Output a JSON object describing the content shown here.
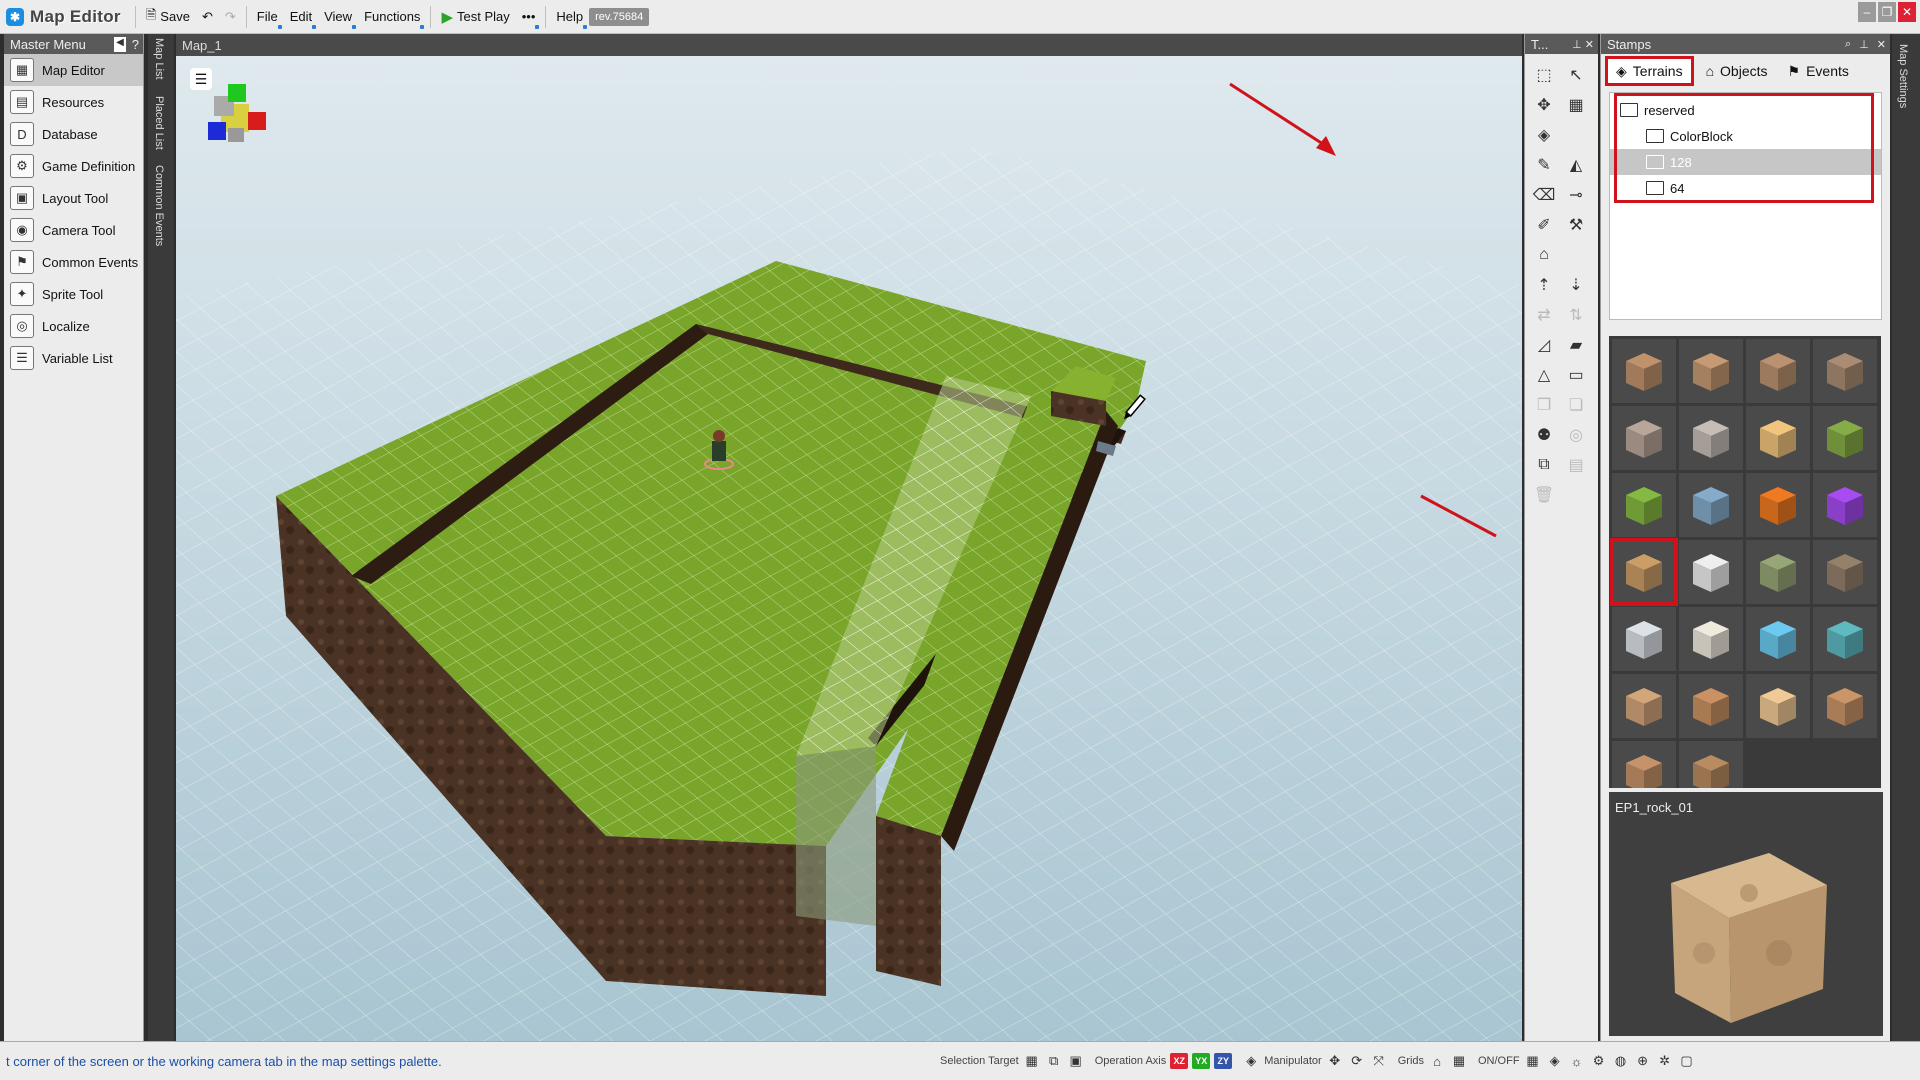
{
  "app": {
    "title": "Map Editor",
    "revision": "rev.75684"
  },
  "toolbar": {
    "save_label": "Save",
    "menus": [
      "File",
      "Edit",
      "View",
      "Functions"
    ],
    "test_play_label": "Test Play",
    "more_label": "•••",
    "help_label": "Help"
  },
  "master_menu": {
    "title": "Master Menu",
    "help": "?",
    "items": [
      {
        "label": "Map Editor",
        "icon": "map-editor-icon"
      },
      {
        "label": "Resources",
        "icon": "resources-icon"
      },
      {
        "label": "Database",
        "icon": "database-icon"
      },
      {
        "label": "Game Definition",
        "icon": "game-definition-icon"
      },
      {
        "label": "Layout Tool",
        "icon": "layout-tool-icon"
      },
      {
        "label": "Camera Tool",
        "icon": "camera-tool-icon"
      },
      {
        "label": "Common Events",
        "icon": "common-events-icon"
      },
      {
        "label": "Sprite Tool",
        "icon": "sprite-tool-icon"
      },
      {
        "label": "Localize",
        "icon": "localize-icon"
      },
      {
        "label": "Variable List",
        "icon": "variable-list-icon"
      }
    ]
  },
  "side_tabs": [
    "Map List",
    "Placed List",
    "Common Events"
  ],
  "viewport": {
    "tab": "Map_1"
  },
  "toolbox": {
    "title": "T..."
  },
  "stamps": {
    "title": "Stamps",
    "tabs": [
      "Terrains",
      "Objects",
      "Events"
    ],
    "tree": [
      {
        "label": "reserved",
        "level": 0
      },
      {
        "label": "ColorBlock",
        "level": 1
      },
      {
        "label": "128",
        "level": 1,
        "selected": true
      },
      {
        "label": "64",
        "level": 1
      }
    ],
    "preview_name": "EP1_rock_01"
  },
  "right_strip": {
    "label": "Map Settings"
  },
  "status": {
    "message": "t corner of the screen or the working camera tab in the map settings palette.",
    "selection_target": "Selection Target",
    "operation_axis": "Operation Axis",
    "axes": [
      "XZ",
      "YX",
      "ZY"
    ],
    "manipulator": "Manipulator",
    "grids": "Grids",
    "onoff": "ON/OFF"
  },
  "colors": {
    "accent": "#d0121b",
    "grass": "#7aa52a",
    "dirt": "#4a3322",
    "sky": "#c4d8e0"
  }
}
